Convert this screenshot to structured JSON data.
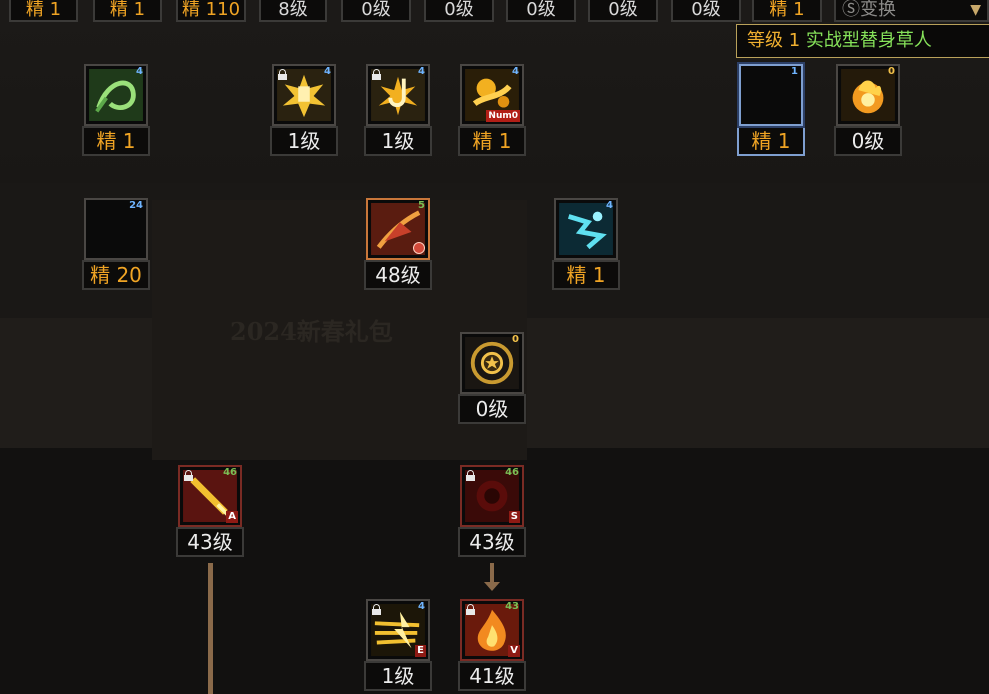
{
  "top_row": [
    {
      "text": "精 1",
      "style": "gold"
    },
    {
      "text": "精 1",
      "style": "gold"
    },
    {
      "text": "精 110",
      "style": "gold"
    },
    {
      "text": "8级",
      "style": "white"
    },
    {
      "text": "0级",
      "style": "white"
    },
    {
      "text": "0级",
      "style": "white"
    },
    {
      "text": "0级",
      "style": "white"
    },
    {
      "text": "0级",
      "style": "white"
    },
    {
      "text": "0级",
      "style": "white"
    },
    {
      "text": "精 1",
      "style": "gold"
    },
    {
      "text": "Ⓢ变换",
      "style": "white"
    }
  ],
  "tooltip": {
    "level": "等级 1",
    "name": "实战型替身草人"
  },
  "skills": {
    "green_whip": {
      "badge": "4",
      "label": "精 1"
    },
    "palm_burst": {
      "badge": "4",
      "label": "1级"
    },
    "hook_flare": {
      "badge": "4",
      "label": "1级"
    },
    "golden_swirl": {
      "badge": "4",
      "key": "Num0",
      "label": "精 1"
    },
    "empty_selected": {
      "badge": "1",
      "label": "精 1"
    },
    "fire_orb": {
      "badge": "0",
      "label": "0级"
    },
    "empty_left": {
      "badge": "24",
      "label": "精 20"
    },
    "crimson_feather": {
      "badge": "5",
      "label": "48级"
    },
    "cyan_spirit": {
      "badge": "4",
      "label": "精 1"
    },
    "golden_emblem": {
      "badge": "0",
      "label": "0级"
    },
    "flame_spear": {
      "badge": "46",
      "key": "A",
      "label": "43级"
    },
    "dark_red": {
      "badge": "46",
      "key": "S",
      "label": "43级"
    },
    "lightning_dash": {
      "badge": "4",
      "key": "E",
      "label": "1级"
    },
    "blaze": {
      "badge": "43",
      "key": "V",
      "label": "41级"
    }
  },
  "background": {
    "banner": "2024新春礼包"
  },
  "colors": {
    "gold": "#f0a424",
    "tooltip_level": "#f0b030",
    "tooltip_name": "#86e25a",
    "level_badge": "#6fb4ff"
  }
}
